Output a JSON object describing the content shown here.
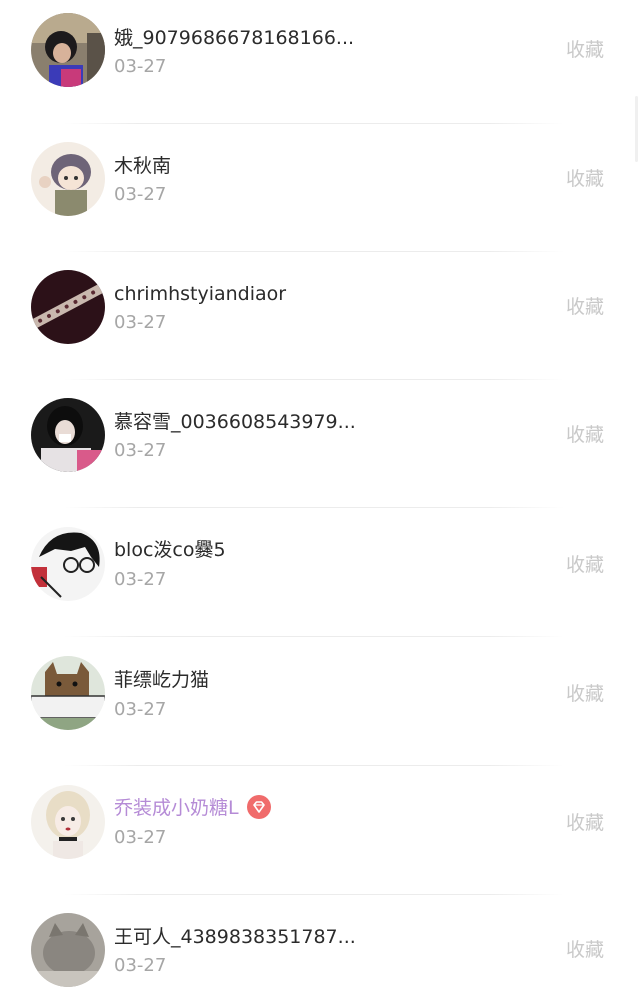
{
  "collect_label": "收藏",
  "items": [
    {
      "username": "娥_9079686678168166...",
      "date": "03-27",
      "vip": false,
      "avatar_icon": "avatar-user-photo-icon"
    },
    {
      "username": "木秋南",
      "date": "03-27",
      "vip": false,
      "avatar_icon": "avatar-anime-girl-icon"
    },
    {
      "username": "chrimhstyiandiaor",
      "date": "03-27",
      "vip": false,
      "avatar_icon": "avatar-dark-pattern-icon"
    },
    {
      "username": "慕容雪_0036608543979...",
      "date": "03-27",
      "vip": false,
      "avatar_icon": "avatar-girl-headphones-icon"
    },
    {
      "username": "bloc泼co爨5",
      "date": "03-27",
      "vip": false,
      "avatar_icon": "avatar-manga-boy-icon"
    },
    {
      "username": "菲缥屹力猫",
      "date": "03-27",
      "vip": false,
      "avatar_icon": "avatar-cat-sign-icon"
    },
    {
      "username": "乔装成小奶糖L",
      "date": "03-27",
      "vip": true,
      "avatar_icon": "avatar-blonde-girl-icon"
    },
    {
      "username": "王可人_4389838351787...",
      "date": "03-27",
      "vip": false,
      "avatar_icon": "avatar-grey-cat-icon"
    }
  ],
  "colors": {
    "username": "#2b2b2b",
    "vip_username": "#b58bd6",
    "date": "#a6a6a6",
    "collect": "#c9c9c9",
    "vip_badge": "#f06b6b"
  }
}
